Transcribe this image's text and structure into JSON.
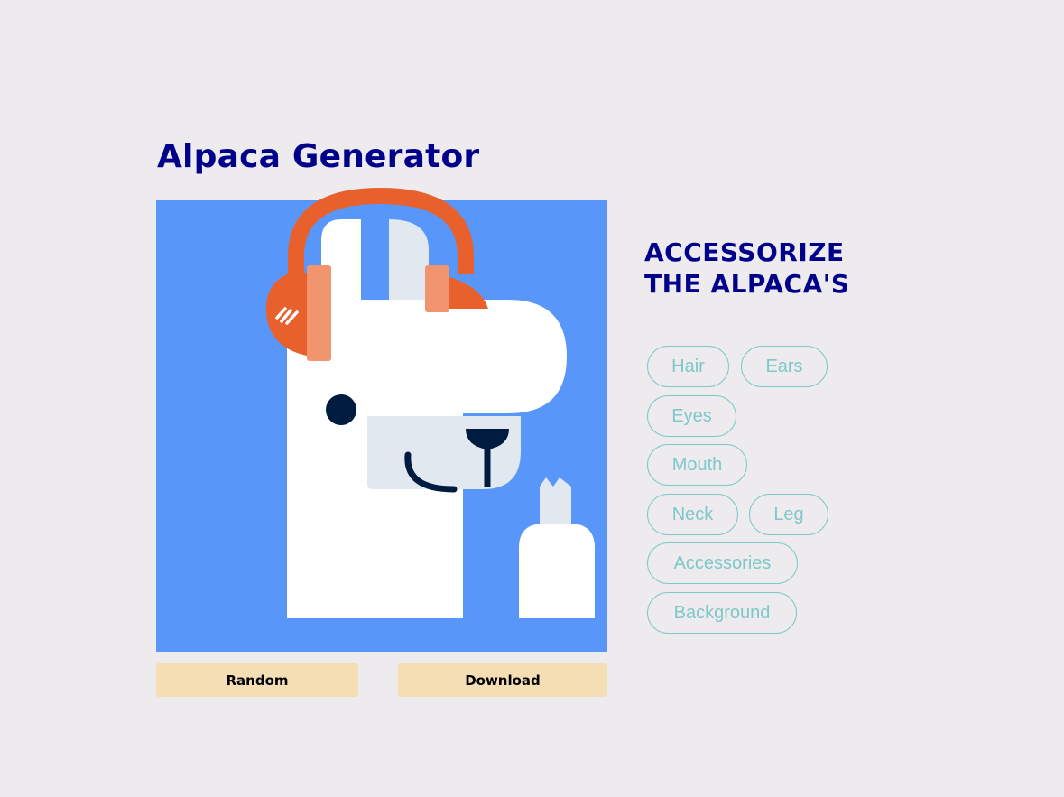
{
  "app": {
    "title": "Alpaca Generator"
  },
  "preview": {
    "background_color": "#5897f9",
    "body_color": "#ffffff",
    "headphone_color": "#e8602c",
    "headphone_pad_color": "#f0956d",
    "nose_color": "#e2e8f0",
    "ear_inner_color": "#e2e8f0",
    "eye_color": "#001b40"
  },
  "actions": {
    "random_label": "Random",
    "download_label": "Download"
  },
  "customize": {
    "heading": "ACCESSORIZE THE ALPACA'S",
    "options": [
      {
        "label": "Hair"
      },
      {
        "label": "Ears"
      },
      {
        "label": "Eyes"
      },
      {
        "label": "Mouth"
      },
      {
        "label": "Neck"
      },
      {
        "label": "Leg"
      },
      {
        "label": "Accessories"
      },
      {
        "label": "Background"
      }
    ]
  }
}
